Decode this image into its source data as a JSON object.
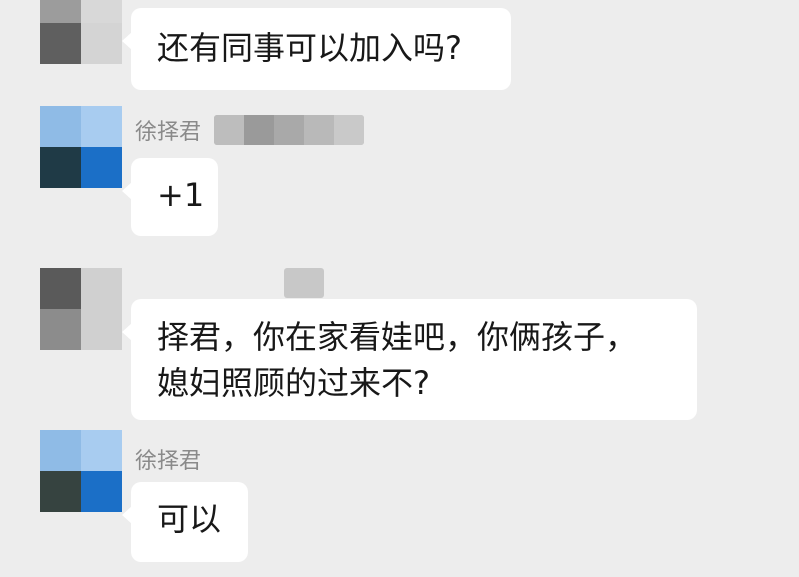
{
  "colors": {
    "background": "#ededed",
    "bubble": "#ffffff",
    "sender_name": "#8a8a8a",
    "message_text": "#181818"
  },
  "messages": [
    {
      "sender": "",
      "avatar": "pixelated-gray-avatar",
      "lines": [
        "还有同事可以加入吗?"
      ]
    },
    {
      "sender": "徐择君",
      "avatar": "pixelated-blue-avatar",
      "lines": [
        "+1"
      ]
    },
    {
      "sender": "",
      "avatar": "pixelated-gray-avatar",
      "lines": [
        "择君，你在家看娃吧，你俩孩子，",
        "媳妇照顾的过来不?"
      ]
    },
    {
      "sender": "徐择君",
      "avatar": "pixelated-blue-avatar",
      "lines": [
        "可以"
      ]
    }
  ]
}
